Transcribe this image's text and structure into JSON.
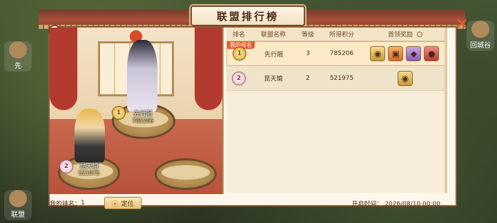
{
  "window": {
    "title": "联盟排行榜",
    "close_icon": "close-icon",
    "help_label": "?"
  },
  "side_buttons": [
    {
      "label": "先"
    },
    {
      "label": "联盟"
    },
    {
      "label": "回城谷"
    }
  ],
  "table": {
    "headers": [
      "排名",
      "联盟名称",
      "等级",
      "所得积分",
      "首领奖励"
    ],
    "mine_tag": "我的排名",
    "rows": [
      {
        "rank": "1",
        "medal": "gold",
        "name": "先行阻",
        "level": "3",
        "score": "785206",
        "rewards": [
          "rw-gold",
          "rw-orange",
          "rw-purple",
          "rw-red"
        ]
      },
      {
        "rank": "2",
        "medal": "silver",
        "name": "昆天瑜",
        "level": "2",
        "score": "521975",
        "rewards": [
          "rw-gold"
        ]
      }
    ]
  },
  "scene": {
    "first": {
      "name": "先行阻",
      "power": "785206"
    },
    "second": {
      "name": "昆天瑜",
      "power": "521975"
    }
  },
  "footer": {
    "my_rank_label": "我的排名：",
    "my_rank_value": "1",
    "locate_label": "定位",
    "open_time_label": "开启时间：",
    "open_time_value": "2026/08/10 00:00"
  }
}
